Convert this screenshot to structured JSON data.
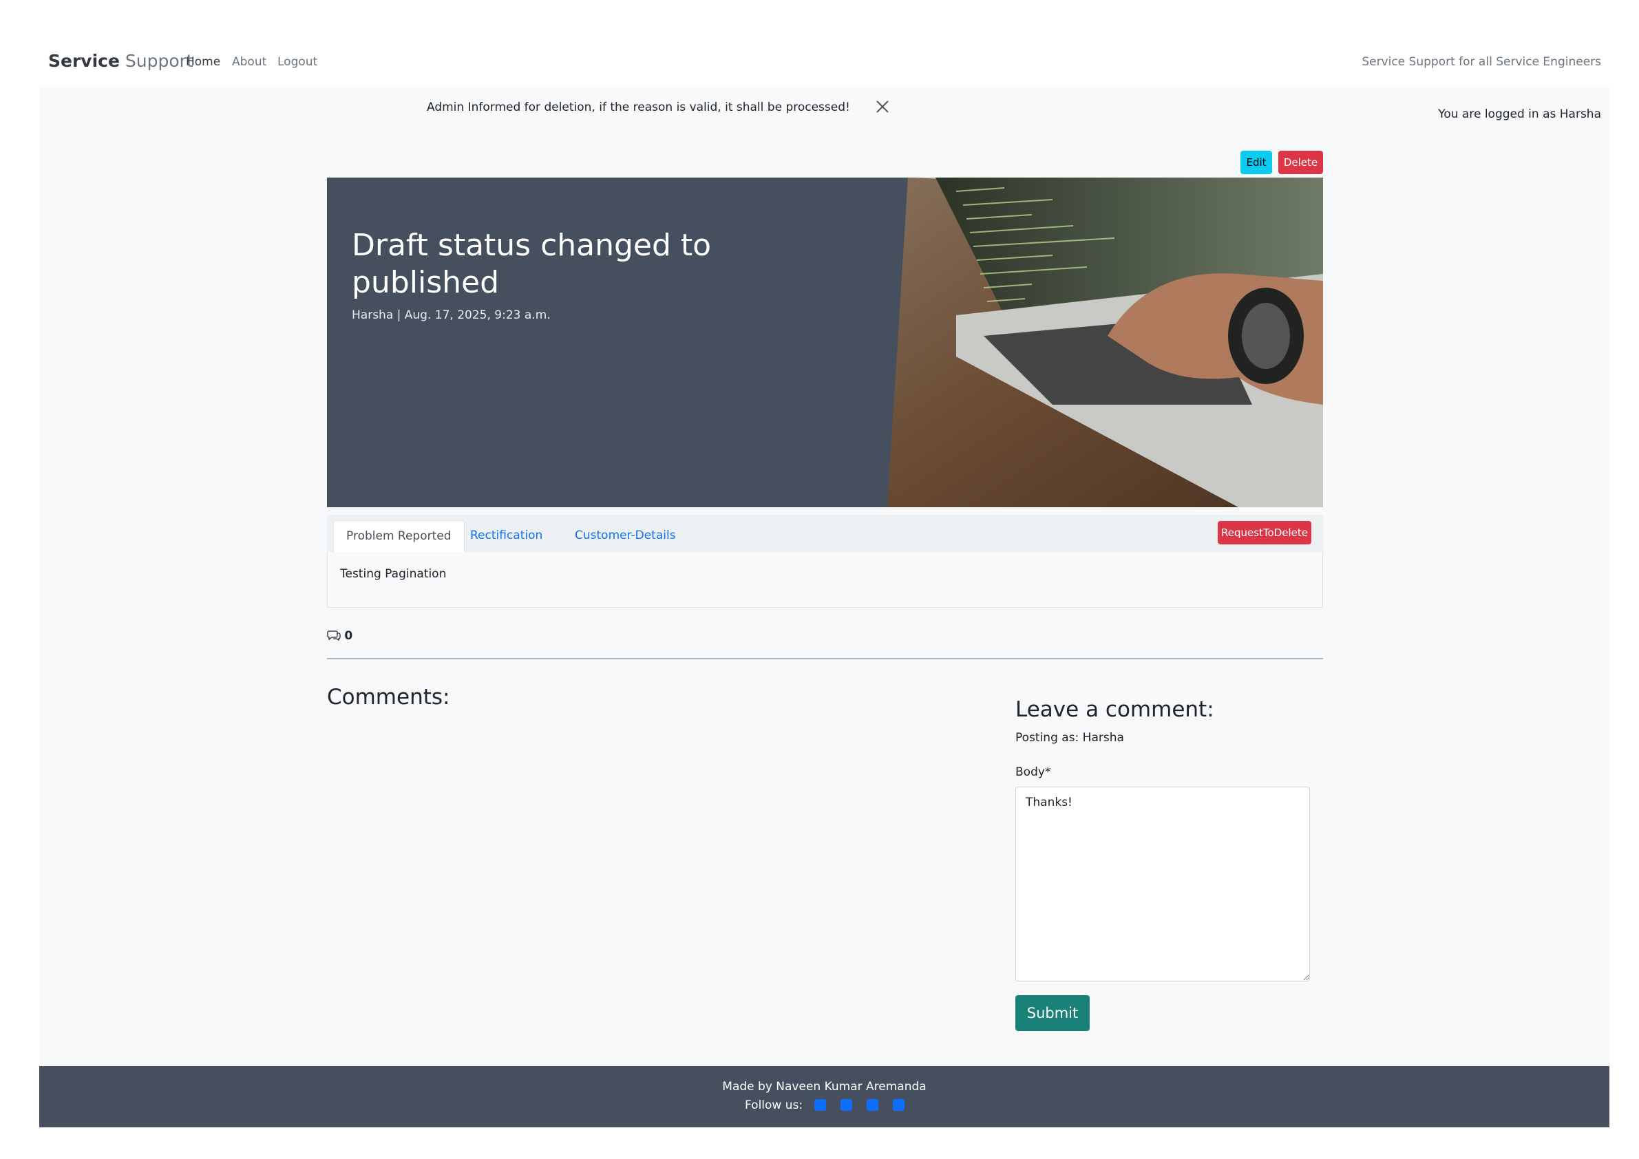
{
  "nav": {
    "brand_bold": "Service",
    "brand_light": " Support",
    "links": [
      "Home",
      "About",
      "Logout"
    ],
    "tagline": "Service Support for all Service Engineers"
  },
  "alert": {
    "message": "Admin Informed for deletion, if the reason is valid, it shall be processed!",
    "close_icon": "close-icon"
  },
  "user": {
    "logged_in_text": "You are logged in as Harsha"
  },
  "post_actions": {
    "edit_label": "Edit",
    "delete_label": "Delete"
  },
  "hero": {
    "title": "Draft status changed to published",
    "meta": "Harsha | Aug. 17, 2025, 9:23 a.m.",
    "background_color": "#454f5e"
  },
  "tabs": {
    "items": [
      "Problem Reported",
      "Rectification",
      "Customer-Details"
    ],
    "active": "Problem Reported",
    "request_delete_label": "RequestToDelete",
    "content": "Testing Pagination"
  },
  "comments": {
    "count": "0",
    "count_icon": "comments-icon",
    "title": "Comments:"
  },
  "comment_form": {
    "title": "Leave a comment:",
    "posting_as": "Posting as: Harsha",
    "body_label": "Body*",
    "body_value": "Thanks!",
    "submit_label": "Submit"
  },
  "footer": {
    "made_by": "Made by Naveen Kumar Aremanda",
    "follow_label": "Follow us:",
    "social_icons": [
      "facebook-icon",
      "twitter-icon",
      "linkedin-icon",
      "youtube-icon"
    ]
  },
  "colors": {
    "accent_info": "#0dcaf0",
    "danger": "#dc3545",
    "submit": "#198178",
    "link": "#0d6efd",
    "footer_bg": "#454f5e"
  }
}
